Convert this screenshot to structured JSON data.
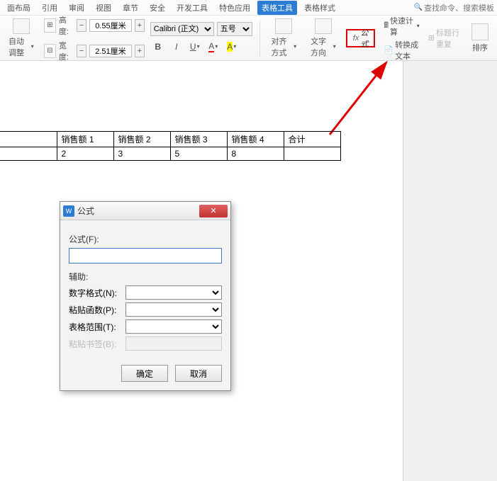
{
  "tabs": {
    "layout": "面布局",
    "refs": "引用",
    "review": "审阅",
    "view": "视图",
    "chapter": "章节",
    "security": "安全",
    "devtools": "开发工具",
    "special": "特色应用",
    "tabletools": "表格工具",
    "tablestyle": "表格样式",
    "search": "查找命令、搜索模板"
  },
  "ribbon": {
    "autofit": "自动调整",
    "height_label": "高度:",
    "height_value": "0.55厘米",
    "width_label": "宽度:",
    "width_value": "2.51厘米",
    "font": "Calibri (正文)",
    "size": "五号",
    "align": "对齐方式",
    "textdir": "文字方向",
    "formula": "公式",
    "quickcalc": "快速计算",
    "titlerepeat": "标题行重复",
    "totext": "转换成文本",
    "sort": "排序"
  },
  "table": {
    "h1": "销售额 1",
    "h2": "销售额 2",
    "h3": "销售额 3",
    "h4": "销售额 4",
    "h5": "合计",
    "r1c1": "2",
    "r1c2": "3",
    "r1c3": "5",
    "r1c4": "8",
    "r1c5": ""
  },
  "dialog": {
    "title": "公式",
    "formula_label": "公式(F):",
    "formula_value": "",
    "assist_label": "辅助:",
    "numfmt_label": "数字格式(N):",
    "pastefunc_label": "粘贴函数(P):",
    "tablerange_label": "表格范围(T):",
    "bookmark_label": "粘贴书签(B):",
    "ok": "确定",
    "cancel": "取消"
  }
}
